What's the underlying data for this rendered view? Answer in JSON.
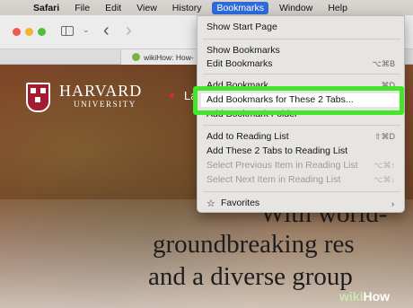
{
  "menubar": {
    "apple_icon": "apple-icon",
    "items": [
      {
        "label": "Safari"
      },
      {
        "label": "File"
      },
      {
        "label": "Edit"
      },
      {
        "label": "View"
      },
      {
        "label": "History"
      },
      {
        "label": "Bookmarks"
      },
      {
        "label": "Window"
      },
      {
        "label": "Help"
      }
    ]
  },
  "tabs": [
    {
      "title": "wikiHow: How-"
    }
  ],
  "page": {
    "university_name": "HARVARD",
    "university_sub": "UNIVERSITY",
    "nav_partial": "La",
    "hero_lines": [
      "With world-",
      "groundbreaking res",
      "and a diverse group"
    ]
  },
  "bookmarks_menu": {
    "items": [
      {
        "label": "Show Start Page",
        "shortcut": ""
      },
      {
        "label": "Show Bookmarks",
        "shortcut": ""
      },
      {
        "label": "Edit Bookmarks",
        "shortcut": "⌥⌘B"
      },
      {
        "label": "Add Bookmark...",
        "shortcut": "⌘D"
      },
      {
        "label": "Add Bookmarks for These 2 Tabs...",
        "shortcut": ""
      },
      {
        "label": "Add Bookmark Folder",
        "shortcut": ""
      },
      {
        "label": "Add to Reading List",
        "shortcut": "⇧⌘D"
      },
      {
        "label": "Add These 2 Tabs to Reading List",
        "shortcut": ""
      },
      {
        "label": "Select Previous Item in Reading List",
        "shortcut": "⌥⌘↑"
      },
      {
        "label": "Select Next Item in Reading List",
        "shortcut": "⌥⌘↓"
      },
      {
        "label": "Favorites",
        "shortcut": ""
      }
    ]
  },
  "watermark": {
    "a": "wiki",
    "b": "How"
  },
  "colors": {
    "highlight_box": "#43e62b",
    "menubar_active": "#2f6bd8",
    "harvard_crimson": "#a51c30"
  }
}
